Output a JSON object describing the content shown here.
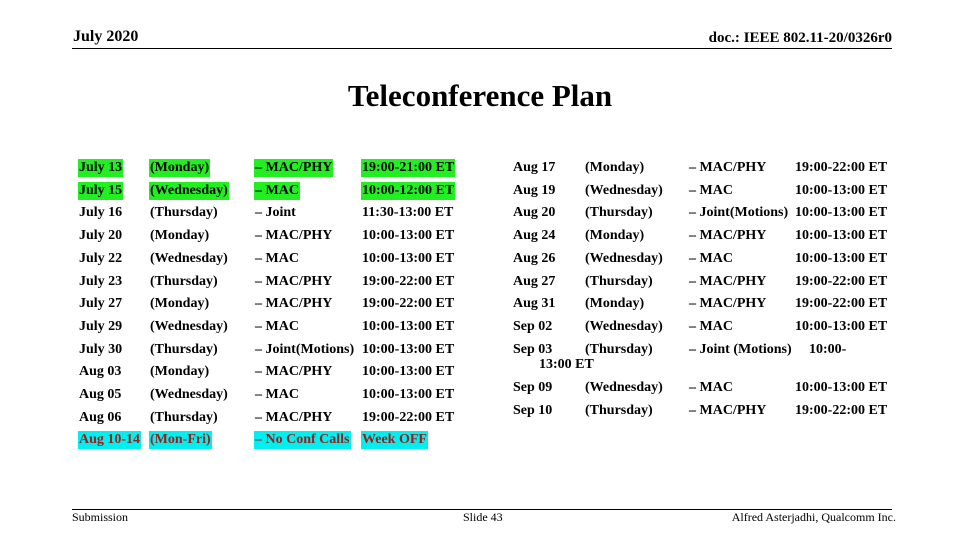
{
  "header": {
    "date": "July 2020",
    "doc": "doc.: IEEE 802.11-20/0326r0"
  },
  "title": "Teleconference Plan",
  "highlight_colors": {
    "green": "#22ee22",
    "cyan": "#00f0f0",
    "cyan_text": "#a01c1c"
  },
  "left_schedule": [
    {
      "date": "July 13",
      "day": "(Monday)",
      "group": "– MAC/PHY",
      "time": "19:00-21:00 ET",
      "highlight": "green"
    },
    {
      "date": "July 15",
      "day": "(Wednesday)",
      "group": "– MAC",
      "time": "10:00-12:00 ET",
      "highlight": "green"
    },
    {
      "date": "July 16",
      "day": "(Thursday)",
      "group": "– Joint",
      "time": "11:30-13:00 ET",
      "highlight": ""
    },
    {
      "date": "July 20",
      "day": "(Monday)",
      "group": "– MAC/PHY",
      "time": "10:00-13:00 ET",
      "highlight": ""
    },
    {
      "date": "July 22",
      "day": "(Wednesday)",
      "group": "– MAC",
      "time": "10:00-13:00 ET",
      "highlight": ""
    },
    {
      "date": "July 23",
      "day": "(Thursday)",
      "group": "– MAC/PHY",
      "time": "19:00-22:00 ET",
      "highlight": ""
    },
    {
      "date": "July 27",
      "day": "(Monday)",
      "group": "– MAC/PHY",
      "time": "19:00-22:00 ET",
      "highlight": ""
    },
    {
      "date": "July 29",
      "day": "(Wednesday)",
      "group": "– MAC",
      "time": "10:00-13:00 ET",
      "highlight": ""
    },
    {
      "date": "July 30",
      "day": "(Thursday)",
      "group": "– Joint(Motions)",
      "time": "10:00-13:00 ET",
      "highlight": ""
    },
    {
      "date": "Aug 03",
      "day": "(Monday)",
      "group": "– MAC/PHY",
      "time": "10:00-13:00 ET",
      "highlight": ""
    },
    {
      "date": "Aug 05",
      "day": "(Wednesday)",
      "group": "– MAC",
      "time": "10:00-13:00 ET",
      "highlight": ""
    },
    {
      "date": "Aug 06",
      "day": "(Thursday)",
      "group": "– MAC/PHY",
      "time": "19:00-22:00 ET",
      "highlight": ""
    },
    {
      "date": "Aug 10-14",
      "day": "(Mon-Fri)",
      "group": "– No Conf Calls",
      "time": "Week OFF",
      "highlight": "cyan"
    }
  ],
  "right_schedule": [
    {
      "date": "Aug 17",
      "day": "(Monday)",
      "group": "– MAC/PHY",
      "time": "19:00-22:00 ET"
    },
    {
      "date": "Aug 19",
      "day": "(Wednesday)",
      "group": "– MAC",
      "time": "10:00-13:00 ET"
    },
    {
      "date": "Aug 20",
      "day": "(Thursday)",
      "group": "– Joint(Motions)",
      "time": "10:00-13:00 ET"
    },
    {
      "date": "Aug 24",
      "day": "(Monday)",
      "group": "– MAC/PHY",
      "time": "10:00-13:00 ET"
    },
    {
      "date": "Aug 26",
      "day": "(Wednesday)",
      "group": "– MAC",
      "time": "10:00-13:00 ET"
    },
    {
      "date": "Aug 27",
      "day": "(Thursday)",
      "group": "– MAC/PHY",
      "time": "19:00-22:00 ET"
    },
    {
      "date": "Aug 31",
      "day": "(Monday)",
      "group": "– MAC/PHY",
      "time": "19:00-22:00 ET"
    },
    {
      "date": "Sep 02",
      "day": "(Wednesday)",
      "group": "– MAC",
      "time": "10:00-13:00 ET"
    },
    {
      "date": "Sep 03",
      "day": "(Thursday)",
      "group": "– Joint (Motions)",
      "time": "10:00-",
      "time_wrap": "13:00 ET"
    },
    {
      "date": "Sep 09",
      "day": "(Wednesday)",
      "group": "– MAC",
      "time": "10:00-13:00 ET"
    },
    {
      "date": "Sep 10",
      "day": "(Thursday)",
      "group": "– MAC/PHY",
      "time": "19:00-22:00 ET"
    }
  ],
  "footer": {
    "left": "Submission",
    "center": "Slide 43",
    "right": "Alfred Asterjadhi, Qualcomm Inc."
  }
}
